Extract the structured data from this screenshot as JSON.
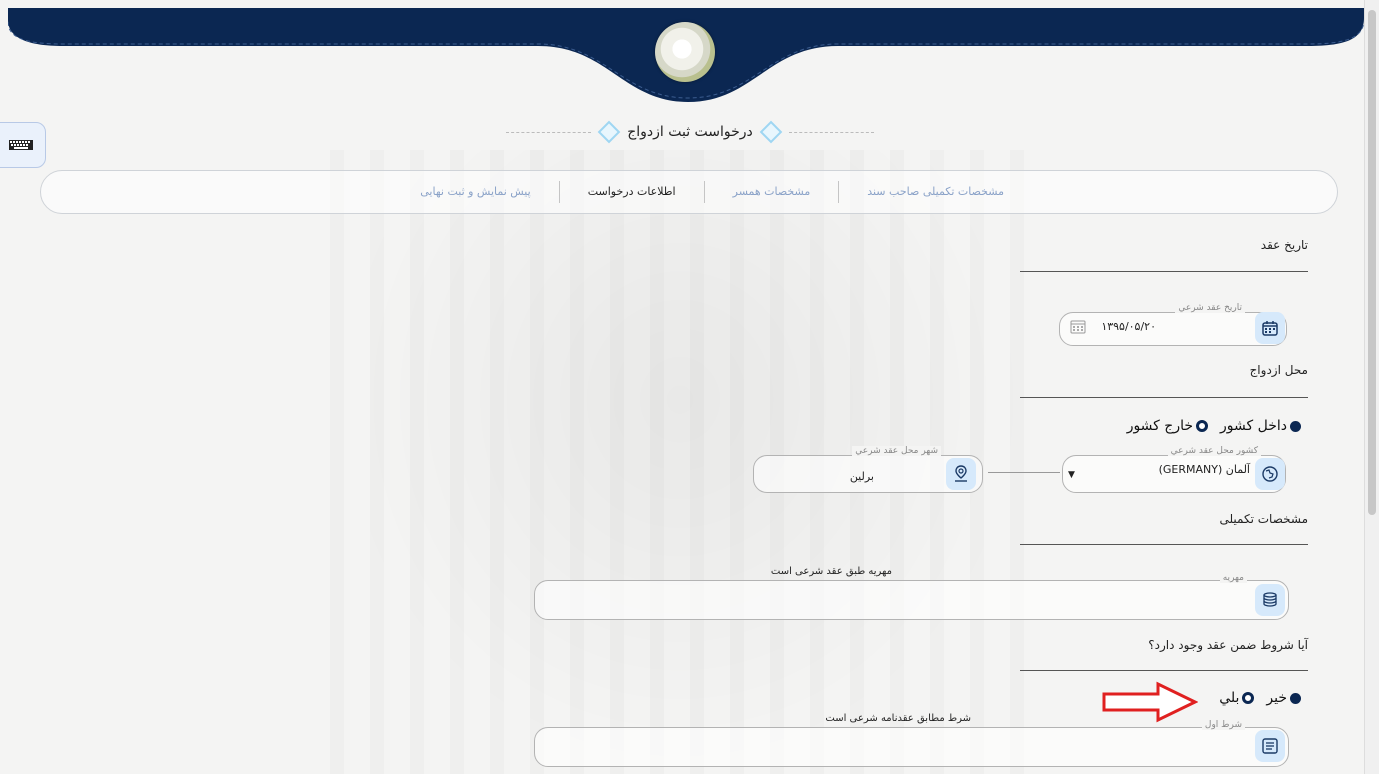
{
  "header": {
    "title": "درخواست ثبت ازدواج",
    "colors": {
      "navy": "#0b2752",
      "accent": "#9fd6f2"
    }
  },
  "keyboard_button": {
    "icon": "keyboard-icon"
  },
  "steps": [
    {
      "label": "مشخصات تکمیلی صاحب سند"
    },
    {
      "label": "مشخصات همسر"
    },
    {
      "label": "اطلاعات درخواست"
    },
    {
      "label": "پیش نمایش و ثبت نهایی"
    }
  ],
  "sections": {
    "date": {
      "heading": "تاریخ عقد",
      "field_label": "تاریخ عقد شرعي",
      "field_value": "۱۳۹۵/۰۵/۲۰"
    },
    "place": {
      "heading": "محل ازدواج",
      "radio_inside": "داخل کشور",
      "radio_outside": "خارج کشور",
      "country_label": "کشور محل عقد شرعي",
      "country_value": "آلمان (GERMANY)",
      "city_label": "شهر محل عقد شرعي",
      "city_value": "برلين"
    },
    "extra": {
      "heading": "مشخصات تکمیلی",
      "mahr_label": "مهريه",
      "mahr_value": "مهریه طبق عقد شرعی است"
    },
    "conditions": {
      "question": "آیا شروط ضمن عقد وجود دارد؟",
      "radio_no": "خیر",
      "radio_yes": "بلي",
      "first_label": "شرط اول",
      "first_value": "شرط مطابق عقدنامه شرعی است"
    }
  }
}
